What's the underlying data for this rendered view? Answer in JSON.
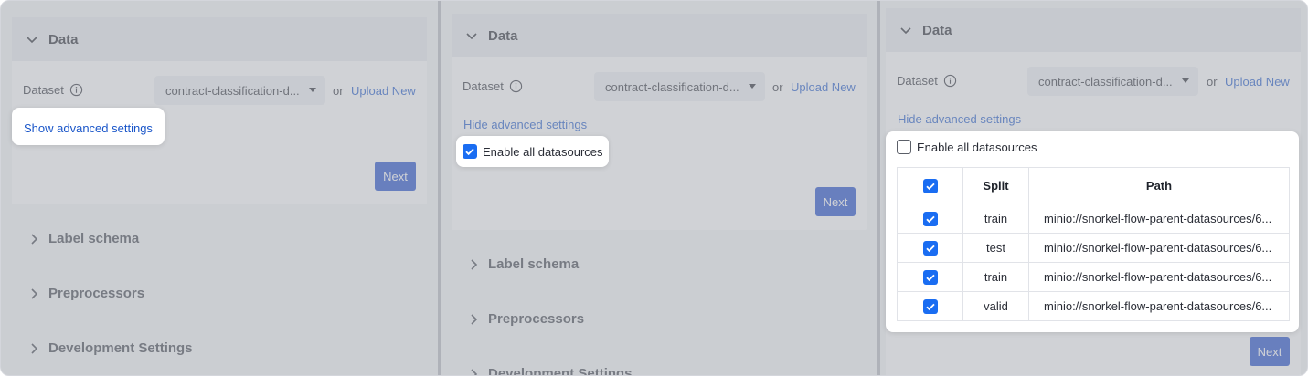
{
  "colors": {
    "accent": "#1a47c9",
    "link": "#1a56c9",
    "checkbox": "#1a6df2"
  },
  "icons": {
    "chevron_down": "chevron-down-icon",
    "chevron_right": "chevron-right-icon",
    "info": "info-icon",
    "check": "check-icon"
  },
  "panels": [
    {
      "header": "Data",
      "dataset_label": "Dataset",
      "dataset_value": "contract-classification-d...",
      "or": "or",
      "upload_link": "Upload New",
      "advanced_link": "Show advanced settings",
      "next_label": "Next",
      "sections": [
        "Label schema",
        "Preprocessors",
        "Development Settings"
      ]
    },
    {
      "header": "Data",
      "dataset_label": "Dataset",
      "dataset_value": "contract-classification-d...",
      "or": "or",
      "upload_link": "Upload New",
      "advanced_link": "Hide advanced settings",
      "enable_label": "Enable all datasources",
      "next_label": "Next",
      "sections": [
        "Label schema",
        "Preprocessors",
        "Development Settings"
      ]
    },
    {
      "header": "Data",
      "dataset_label": "Dataset",
      "dataset_value": "contract-classification-d...",
      "or": "or",
      "upload_link": "Upload New",
      "advanced_link": "Hide advanced settings",
      "enable_label": "Enable all datasources",
      "next_label": "Next",
      "table": {
        "columns": [
          "Split",
          "Path"
        ],
        "rows": [
          {
            "split": "train",
            "path": "minio://snorkel-flow-parent-datasources/6..."
          },
          {
            "split": "test",
            "path": "minio://snorkel-flow-parent-datasources/6..."
          },
          {
            "split": "train",
            "path": "minio://snorkel-flow-parent-datasources/6..."
          },
          {
            "split": "valid",
            "path": "minio://snorkel-flow-parent-datasources/6..."
          }
        ]
      }
    }
  ]
}
